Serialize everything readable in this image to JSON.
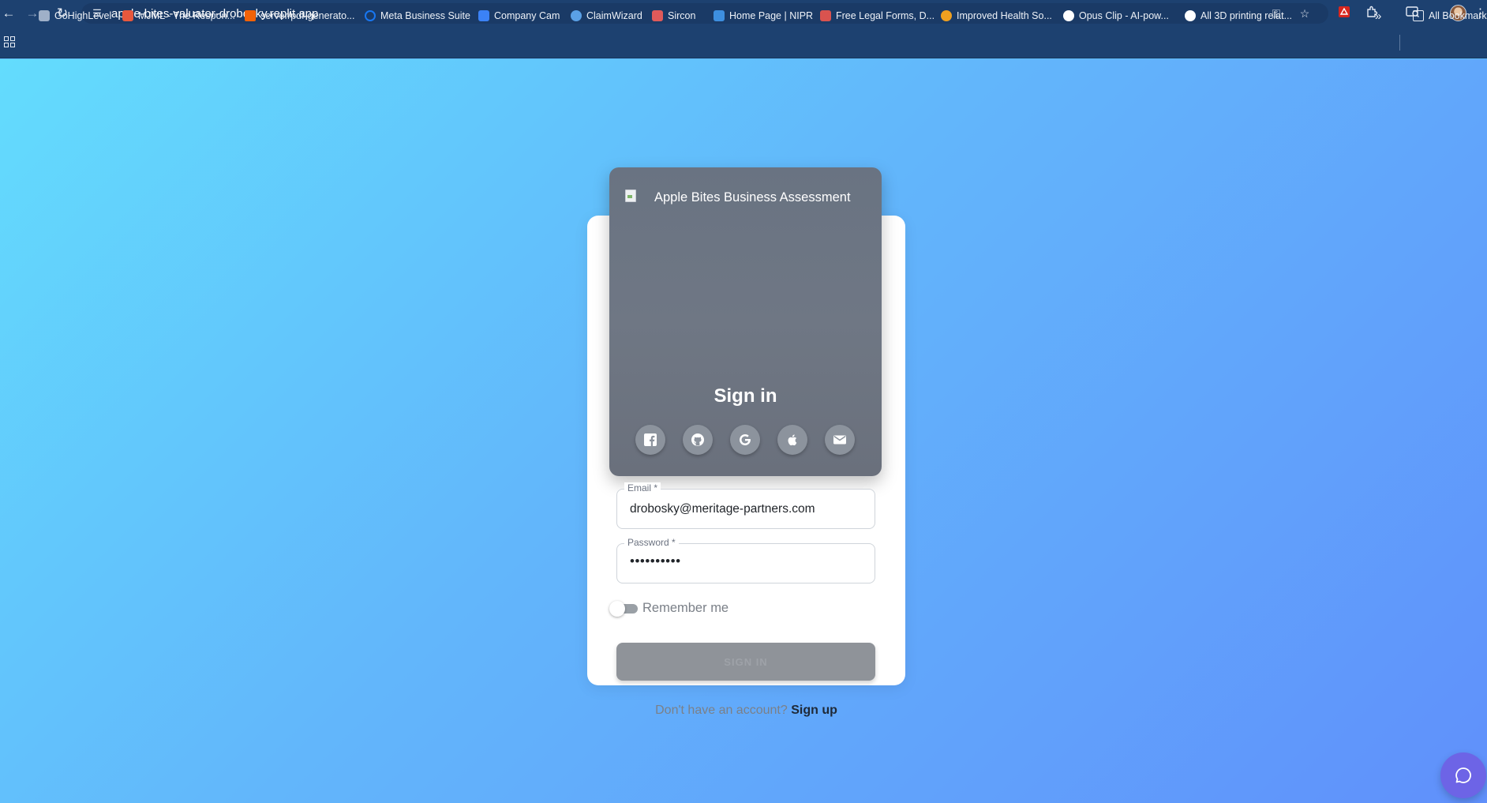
{
  "browser": {
    "url": "apple-bites-valuator-drobosky.replit.app",
    "bookmarks": [
      {
        "label": "GoHighLevel",
        "icon": "gohighlevel-icon",
        "color": "#9fb0c8"
      },
      {
        "label": "MJML - The Respon...",
        "icon": "mjml-icon",
        "color": "#e8583d"
      },
      {
        "label": "server/pdf-generato...",
        "icon": "replit-icon",
        "color": "#f26207"
      },
      {
        "label": "Meta Business Suite",
        "icon": "meta-icon",
        "color": "#1877f2"
      },
      {
        "label": "Company Cam",
        "icon": "companycam-icon",
        "color": "#3b82f6"
      },
      {
        "label": "ClaimWizard",
        "icon": "claimwizard-icon",
        "color": "#5aa0e6"
      },
      {
        "label": "Sircon",
        "icon": "sircon-icon",
        "color": "#e05a5a"
      },
      {
        "label": "Home Page | NIPR",
        "icon": "nipr-icon",
        "color": "#3d8fe0"
      },
      {
        "label": "Free Legal Forms, D...",
        "icon": "legalforms-icon",
        "color": "#d9534f"
      },
      {
        "label": "Improved Health So...",
        "icon": "health-icon",
        "color": "#f0a020"
      },
      {
        "label": "Opus Clip - AI-pow...",
        "icon": "opusclip-icon",
        "color": "#ffffff"
      },
      {
        "label": "All 3D printing relat...",
        "icon": "globe-icon",
        "color": "#ffffff"
      }
    ],
    "all_bookmarks_label": "All Bookmarks"
  },
  "header": {
    "app_title": "Apple Bites Business Assessment",
    "signin_title": "Sign in",
    "social_icons": [
      "facebook-icon",
      "github-icon",
      "google-icon",
      "apple-icon",
      "email-icon"
    ]
  },
  "form": {
    "email_label": "Email *",
    "email_value": "drobosky@meritage-partners.com",
    "password_label": "Password *",
    "password_value": "••••••••••",
    "remember_label": "Remember me",
    "remember_checked": false,
    "submit_label": "SIGN IN",
    "signup_prompt": "Don't have an account?",
    "signup_link": "Sign up"
  },
  "colors": {
    "chrome": "#1d4170",
    "gradient_start": "#63dcfd",
    "gradient_end": "#6090fb",
    "header_card": "#6f7784",
    "chat_button": "#6d64e6"
  }
}
